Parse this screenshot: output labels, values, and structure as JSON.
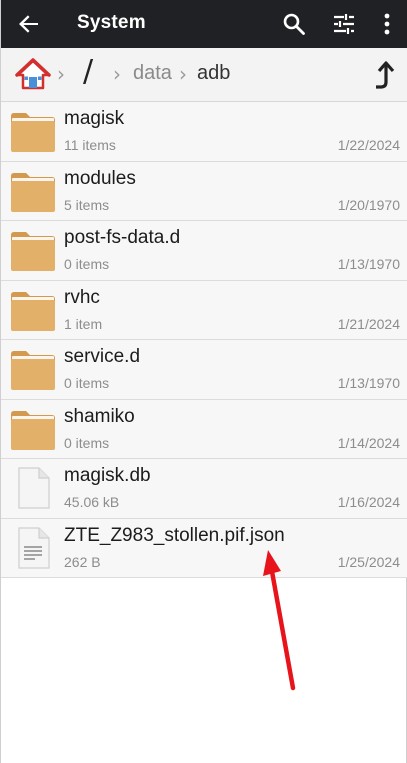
{
  "appbar": {
    "title": "System",
    "back_icon": "arrow-back-icon",
    "search_icon": "search-icon",
    "filter_icon": "tune-icon",
    "more_icon": "more-vert-icon"
  },
  "pathbar": {
    "home_icon": "home-icon",
    "crumbs": [
      "/",
      "data",
      "adb"
    ],
    "up_icon": "arrow-up-icon"
  },
  "files": [
    {
      "name": "magisk",
      "meta": "11 items",
      "date": "1/22/2024",
      "type": "folder"
    },
    {
      "name": "modules",
      "meta": "5 items",
      "date": "1/20/1970",
      "type": "folder"
    },
    {
      "name": "post-fs-data.d",
      "meta": "0 items",
      "date": "1/13/1970",
      "type": "folder"
    },
    {
      "name": "rvhc",
      "meta": "1 item",
      "date": "1/21/2024",
      "type": "folder"
    },
    {
      "name": "service.d",
      "meta": "0 items",
      "date": "1/13/1970",
      "type": "folder"
    },
    {
      "name": "shamiko",
      "meta": "0 items",
      "date": "1/14/2024",
      "type": "folder"
    },
    {
      "name": "magisk.db",
      "meta": "45.06 kB",
      "date": "1/16/2024",
      "type": "file"
    },
    {
      "name": "ZTE_Z983_stollen.pif.json",
      "meta": "262 B",
      "date": "1/25/2024",
      "type": "text-file"
    }
  ],
  "colors": {
    "appbar": "#202124",
    "folder": "#e3b069",
    "folder_tab": "#d39a4f",
    "annotation_arrow": "#e8141c"
  }
}
